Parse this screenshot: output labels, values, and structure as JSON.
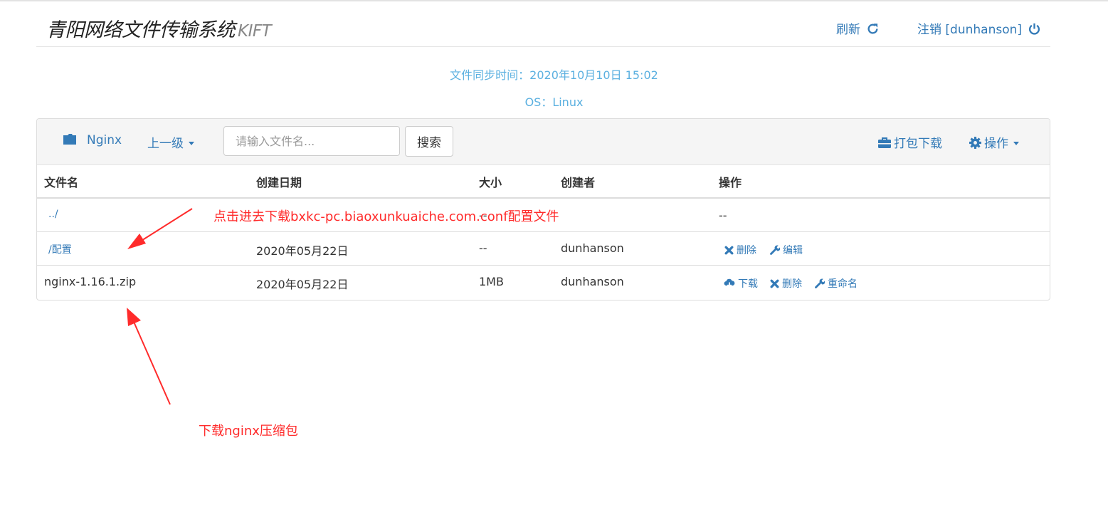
{
  "header": {
    "title": "青阳网络文件传输系统",
    "subtitle": "KIFT",
    "refresh_label": "刷新",
    "logout_label": "注销 [dunhanson]"
  },
  "info": {
    "sync_time": "文件同步时间：2020年10月10日 15:02",
    "os": "OS：Linux"
  },
  "toolbar": {
    "current_folder": "Nginx",
    "parent_label": "上一级",
    "search_placeholder": "请输入文件名...",
    "search_button": "搜索",
    "pack_download": "打包下载",
    "operations": "操作"
  },
  "table": {
    "columns": [
      "文件名",
      "创建日期",
      "大小",
      "创建者",
      "操作"
    ],
    "rows": [
      {
        "name": "../",
        "date": "",
        "size": "--",
        "creator": "",
        "actions_text": "--"
      },
      {
        "name": "/配置",
        "date": "2020年05月22日",
        "size": "--",
        "creator": "dunhanson",
        "actions": [
          "删除",
          "编辑"
        ]
      },
      {
        "name": "nginx-1.16.1.zip",
        "date": "2020年05月22日",
        "size": "1MB",
        "creator": "dunhanson",
        "actions": [
          "下载",
          "删除",
          "重命名"
        ]
      }
    ]
  },
  "annotations": {
    "note1": "点击进去下载bxkc-pc.biaoxunkuaiche.com.conf配置文件",
    "note2": "下载nginx压缩包"
  },
  "colors": {
    "link": "#337ab7",
    "info_text": "#5bb0e0",
    "annotation": "#ff2b2b",
    "toolbar_bg": "#f5f5f5"
  },
  "icons": [
    "refresh-icon",
    "power-icon",
    "folder-icon",
    "briefcase-icon",
    "gear-icon",
    "remove-icon",
    "wrench-icon",
    "cloud-download-icon"
  ]
}
